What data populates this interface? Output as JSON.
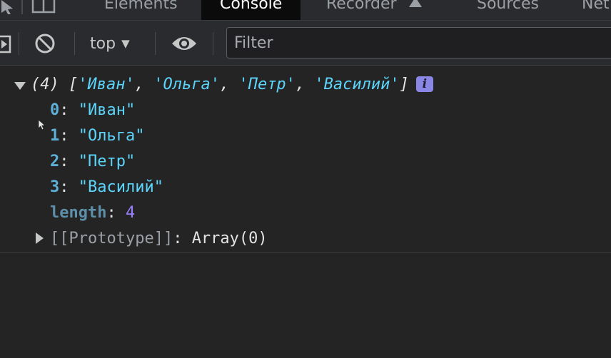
{
  "tabs": [
    {
      "label": "Elements",
      "active": false
    },
    {
      "label": "Console",
      "active": true
    },
    {
      "label": "Recorder",
      "active": false
    },
    {
      "label": "Sources",
      "active": false
    },
    {
      "label": "Net",
      "active": false
    }
  ],
  "toolbar": {
    "context": "top",
    "filter_placeholder": "Filter"
  },
  "console": {
    "summary": {
      "count": "(4)",
      "open_bracket": "[",
      "close_bracket": "]",
      "items": [
        "'Иван'",
        "'Ольга'",
        "'Петр'",
        "'Василий'"
      ],
      "sep": ", ",
      "info": "i"
    },
    "entries": [
      {
        "key": "0",
        "value": "\"Иван\""
      },
      {
        "key": "1",
        "value": "\"Ольга\""
      },
      {
        "key": "2",
        "value": "\"Петр\""
      },
      {
        "key": "3",
        "value": "\"Василий\""
      }
    ],
    "length": {
      "key": "length",
      "value": "4"
    },
    "prototype": {
      "key": "[[Prototype]]",
      "value": "Array(0)"
    },
    "colon": ": "
  },
  "colors": {
    "string": "#5cd5fb",
    "key": "#5db0d7",
    "number": "#9980ff",
    "badge": "#8a86e6",
    "active_tab_bg": "#0b0b0c"
  },
  "icons": [
    "inspect-icon",
    "device-toolbar-icon",
    "recorder-icon",
    "sidebar-toggle-icon",
    "clear-console-icon",
    "eye-icon",
    "expand-arrow-icon",
    "collapse-arrow-icon",
    "info-icon",
    "mouse-cursor-icon"
  ]
}
